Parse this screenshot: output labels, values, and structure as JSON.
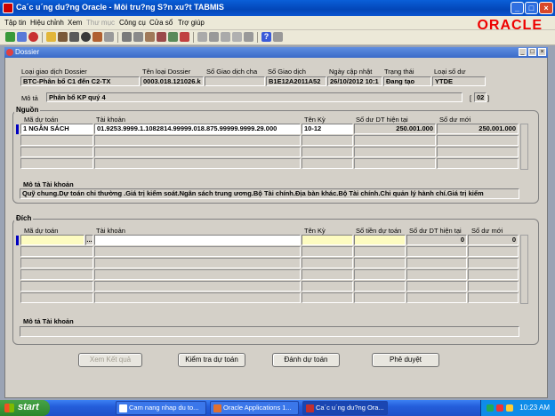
{
  "window": {
    "title": "Ca´c u´ng du?ng Oracle - Môi tru?ng S?n xu?t TABMIS"
  },
  "menu": [
    {
      "label": "Tập tin",
      "disabled": false
    },
    {
      "label": "Hiệu chỉnh",
      "disabled": false
    },
    {
      "label": "Xem",
      "disabled": false
    },
    {
      "label": "Thư mục",
      "disabled": true
    },
    {
      "label": "Công cụ",
      "disabled": false
    },
    {
      "label": "Cửa sổ",
      "disabled": false
    },
    {
      "label": "Trợ giúp",
      "disabled": false
    }
  ],
  "brand": {
    "logo": "ORACLE",
    "color": "#e00000"
  },
  "form": {
    "title": "Dossier"
  },
  "header": {
    "labels": {
      "loai_gd": "Loại giao dịch Dossier",
      "ten_loai": "Tên loại Dossier",
      "so_gd_cha": "Số Giao dịch cha",
      "so_gd": "Số Giao dịch",
      "ngay": "Ngày cập nhật",
      "trang_thai": "Trạng thái",
      "loai_so_du": "Loại số dư",
      "mo_ta": "Mô tả"
    },
    "values": {
      "loai_gd": "BTC-Phân bổ C1 đến C2-TX",
      "ten_loai": "0003.018.121026.k",
      "so_gd_cha": "",
      "so_gd": "B1E12A2011A52",
      "ngay": "26/10/2012 10:1",
      "trang_thai": "Đang tạo",
      "loai_so_du": "YTDE",
      "mo_ta": "Phân bổ KP quý 4",
      "mo_ta_count": "02"
    }
  },
  "nguon": {
    "title": "Nguồn",
    "columns": [
      "Mã dự toán",
      "Tài khoản",
      "Tên Kỳ",
      "Số dư DT hiện tại",
      "Số dư mới"
    ],
    "rows": [
      {
        "ma": "1 NGÂN SÁCH",
        "tk": "01.9253.9999.1.1082814.99999.018.875.99999.9999.29.000",
        "ky": "10-12",
        "hien_tai": "250.001.000",
        "moi": "250.001.000"
      }
    ],
    "desc_label": "Mô tả Tài khoản",
    "desc_value": "Quỹ chung.Dự toán chi thường .Giá trị kiểm soát.Ngân sách trung ương.Bộ Tài chính.Địa bàn khác.Bộ Tài chính.Chi quản lý hành chí.Giá trị kiểm"
  },
  "dich": {
    "title": "Đích",
    "columns": [
      "Mã dự toán",
      "Tài khoản",
      "Tên Kỳ",
      "Số tiền dự toán",
      "Số dư DT hiện tại",
      "Số dư mới"
    ],
    "rows": [
      {
        "ma": "",
        "more": "...",
        "tk": "",
        "ky": "",
        "so_tien": "",
        "hien_tai": "0",
        "moi": "0"
      }
    ],
    "desc_label": "Mô tả Tài khoản",
    "desc_value": ""
  },
  "buttons": {
    "xem_ket_qua": "Xem Kết quả",
    "kiem_tra": "Kiểm tra dự toán",
    "danh_du_toan": "Đánh dự toán",
    "phe_duyet": "Phê duyệt"
  },
  "taskbar": {
    "start": "start",
    "tasks": [
      "Cam nang nhap du to...",
      "Oracle Applications 1...",
      "Ca´c u´ng du?ng Ora..."
    ],
    "clock": "10:23 AM"
  }
}
